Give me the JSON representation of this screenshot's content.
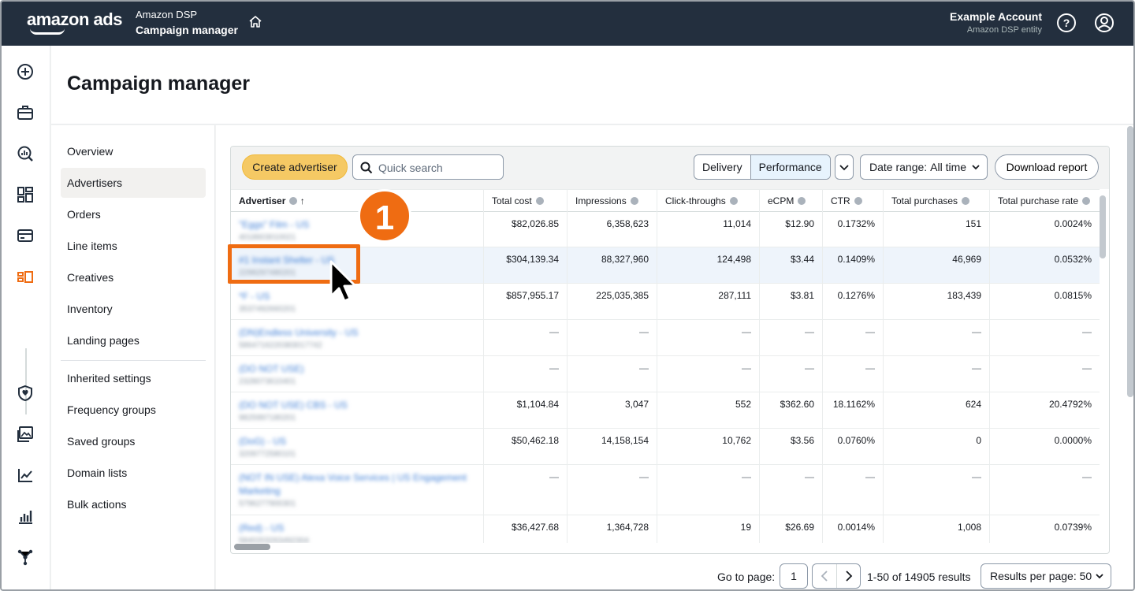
{
  "header": {
    "logo": "amazon ads",
    "product_line1": "Amazon DSP",
    "product_line2": "Campaign manager",
    "account_name": "Example Account",
    "account_entity": "Amazon DSP entity"
  },
  "page": {
    "title": "Campaign manager"
  },
  "subnav": {
    "items": [
      "Overview",
      "Advertisers",
      "Orders",
      "Line items",
      "Creatives",
      "Inventory",
      "Landing pages"
    ],
    "items2": [
      "Inherited settings",
      "Frequency groups",
      "Saved groups",
      "Domain lists",
      "Bulk actions"
    ],
    "active": "Advertisers"
  },
  "toolbar": {
    "create_label": "Create advertiser",
    "search_placeholder": "Quick search",
    "seg_delivery": "Delivery",
    "seg_performance": "Performance",
    "date_label": "Date range:",
    "date_value": "All time",
    "download_label": "Download report"
  },
  "table": {
    "columns": [
      "Advertiser",
      "Total cost",
      "Impressions",
      "Click-throughs",
      "eCPM",
      "CTR",
      "Total purchases",
      "Total purchase rate"
    ],
    "sort_indicator": "↑",
    "rows": [
      {
        "name": "\"Eggs\" Film - US",
        "id": "4018603010021",
        "cost": "$82,026.85",
        "impressions": "6,358,623",
        "clicks": "11,014",
        "ecpm": "$12.90",
        "ctr": "0.1732%",
        "purchases": "151",
        "rate": "0.0024%"
      },
      {
        "name": "#1 Instant Shelter - US",
        "id": "2299297480201",
        "cost": "$304,139.34",
        "impressions": "88,327,960",
        "clicks": "124,498",
        "ecpm": "$3.44",
        "ctr": "0.1409%",
        "purchases": "46,969",
        "rate": "0.0532%"
      },
      {
        "name": "*F - US",
        "id": "3537492660201",
        "cost": "$857,955.17",
        "impressions": "225,035,385",
        "clicks": "287,111",
        "ecpm": "$3.81",
        "ctr": "0.1276%",
        "purchases": "183,439",
        "rate": "0.0815%"
      },
      {
        "name": "(DN)Endless University - US",
        "id": "5864716220383017742",
        "cost": "—",
        "impressions": "—",
        "clicks": "—",
        "ecpm": "—",
        "ctr": "—",
        "purchases": "—",
        "rate": "—"
      },
      {
        "name": "(DO NOT USE)",
        "id": "2328073610401",
        "cost": "—",
        "impressions": "—",
        "clicks": "—",
        "ecpm": "—",
        "ctr": "—",
        "purchases": "—",
        "rate": "—"
      },
      {
        "name": "(DO NOT USE) CBS - US",
        "id": "9825997180201",
        "cost": "$1,104.84",
        "impressions": "3,047",
        "clicks": "552",
        "ecpm": "$362.60",
        "ctr": "18.1162%",
        "purchases": "624",
        "rate": "20.4792%"
      },
      {
        "name": "(DoG) - US",
        "id": "3209772580101",
        "cost": "$50,462.18",
        "impressions": "14,158,154",
        "clicks": "10,762",
        "ecpm": "$3.56",
        "ctr": "0.0760%",
        "purchases": "0",
        "rate": "0.0000%"
      },
      {
        "name": "(NOT IN USE) Alexa Voice Services | US Engagement Marketing",
        "id": "5796277900301",
        "cost": "—",
        "impressions": "—",
        "clicks": "—",
        "ecpm": "—",
        "ctr": "—",
        "purchases": "—",
        "rate": "—"
      },
      {
        "name": "(Red) - US",
        "id": "5840203263492304",
        "cost": "$36,427.68",
        "impressions": "1,364,728",
        "clicks": "19",
        "ecpm": "$26.69",
        "ctr": "0.0014%",
        "purchases": "1,008",
        "rate": "0.0739%"
      }
    ]
  },
  "pagination": {
    "goto_label": "Go to page:",
    "page_value": "1",
    "count_label": "1-50 of 14905 results",
    "rpp_label": "Results per page:",
    "rpp_value": "50"
  },
  "annotation": {
    "step": "1"
  },
  "colors": {
    "topbar": "#232f3e",
    "create_button": "#f5c964",
    "callout": "#ef6c12",
    "link": "#3f7fd6"
  }
}
